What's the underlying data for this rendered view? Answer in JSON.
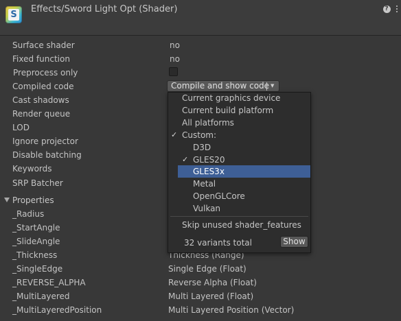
{
  "header": {
    "title": "Effects/Sword Light Opt (Shader)",
    "icon": "shader-icon",
    "icon_letter": "S",
    "help_glyph": "?",
    "menu_icon": "kebab-menu-icon"
  },
  "info": {
    "surface_shader_label": "Surface shader",
    "surface_shader_value": "no",
    "fixed_function_label": "Fixed function",
    "fixed_function_value": "no",
    "preprocess_label": "Preprocess only",
    "preprocess_checked": false,
    "compiled_code_label": "Compiled code",
    "compiled_code_button": "Compile and show code",
    "cast_shadows_label": "Cast shadows",
    "render_queue_label": "Render queue",
    "lod_label": "LOD",
    "ignore_projector_label": "Ignore projector",
    "disable_batching_label": "Disable batching",
    "keywords_label": "Keywords",
    "srp_batcher_label": "SRP Batcher"
  },
  "properties": {
    "header": "Properties",
    "items": [
      {
        "name": "_Radius",
        "value": ""
      },
      {
        "name": "_StartAngle",
        "value": ""
      },
      {
        "name": "_SlideAngle",
        "value": ""
      },
      {
        "name": "_Thickness",
        "value": "Thickness (Range)"
      },
      {
        "name": "_SingleEdge",
        "value": "Single Edge (Float)"
      },
      {
        "name": "_REVERSE_ALPHA",
        "value": "Reverse Alpha (Float)"
      },
      {
        "name": "_MultiLayered",
        "value": "Multi Layered (Float)"
      },
      {
        "name": "_MultiLayeredPosition",
        "value": "Multi Layered Position (Vector)"
      }
    ]
  },
  "popup": {
    "options": [
      {
        "label": "Current graphics device",
        "checked": false
      },
      {
        "label": "Current build platform",
        "checked": false
      },
      {
        "label": "All platforms",
        "checked": false
      },
      {
        "label": "Custom:",
        "checked": true
      },
      {
        "label": "D3D",
        "checked": false
      },
      {
        "label": "GLES20",
        "checked": true
      },
      {
        "label": "GLES3x",
        "checked": false,
        "highlighted": true
      },
      {
        "label": "Metal",
        "checked": false
      },
      {
        "label": "OpenGLCore",
        "checked": false
      },
      {
        "label": "Vulkan",
        "checked": false
      }
    ],
    "skip_unused": "Skip unused shader_features",
    "variants_total": "32 variants total",
    "show_button": "Show",
    "check_glyph": "✓"
  },
  "colors": {
    "background": "#383838",
    "header_bg": "#3c3c3c",
    "popup_bg": "#2d2d2d",
    "highlight": "#3e5f96"
  }
}
